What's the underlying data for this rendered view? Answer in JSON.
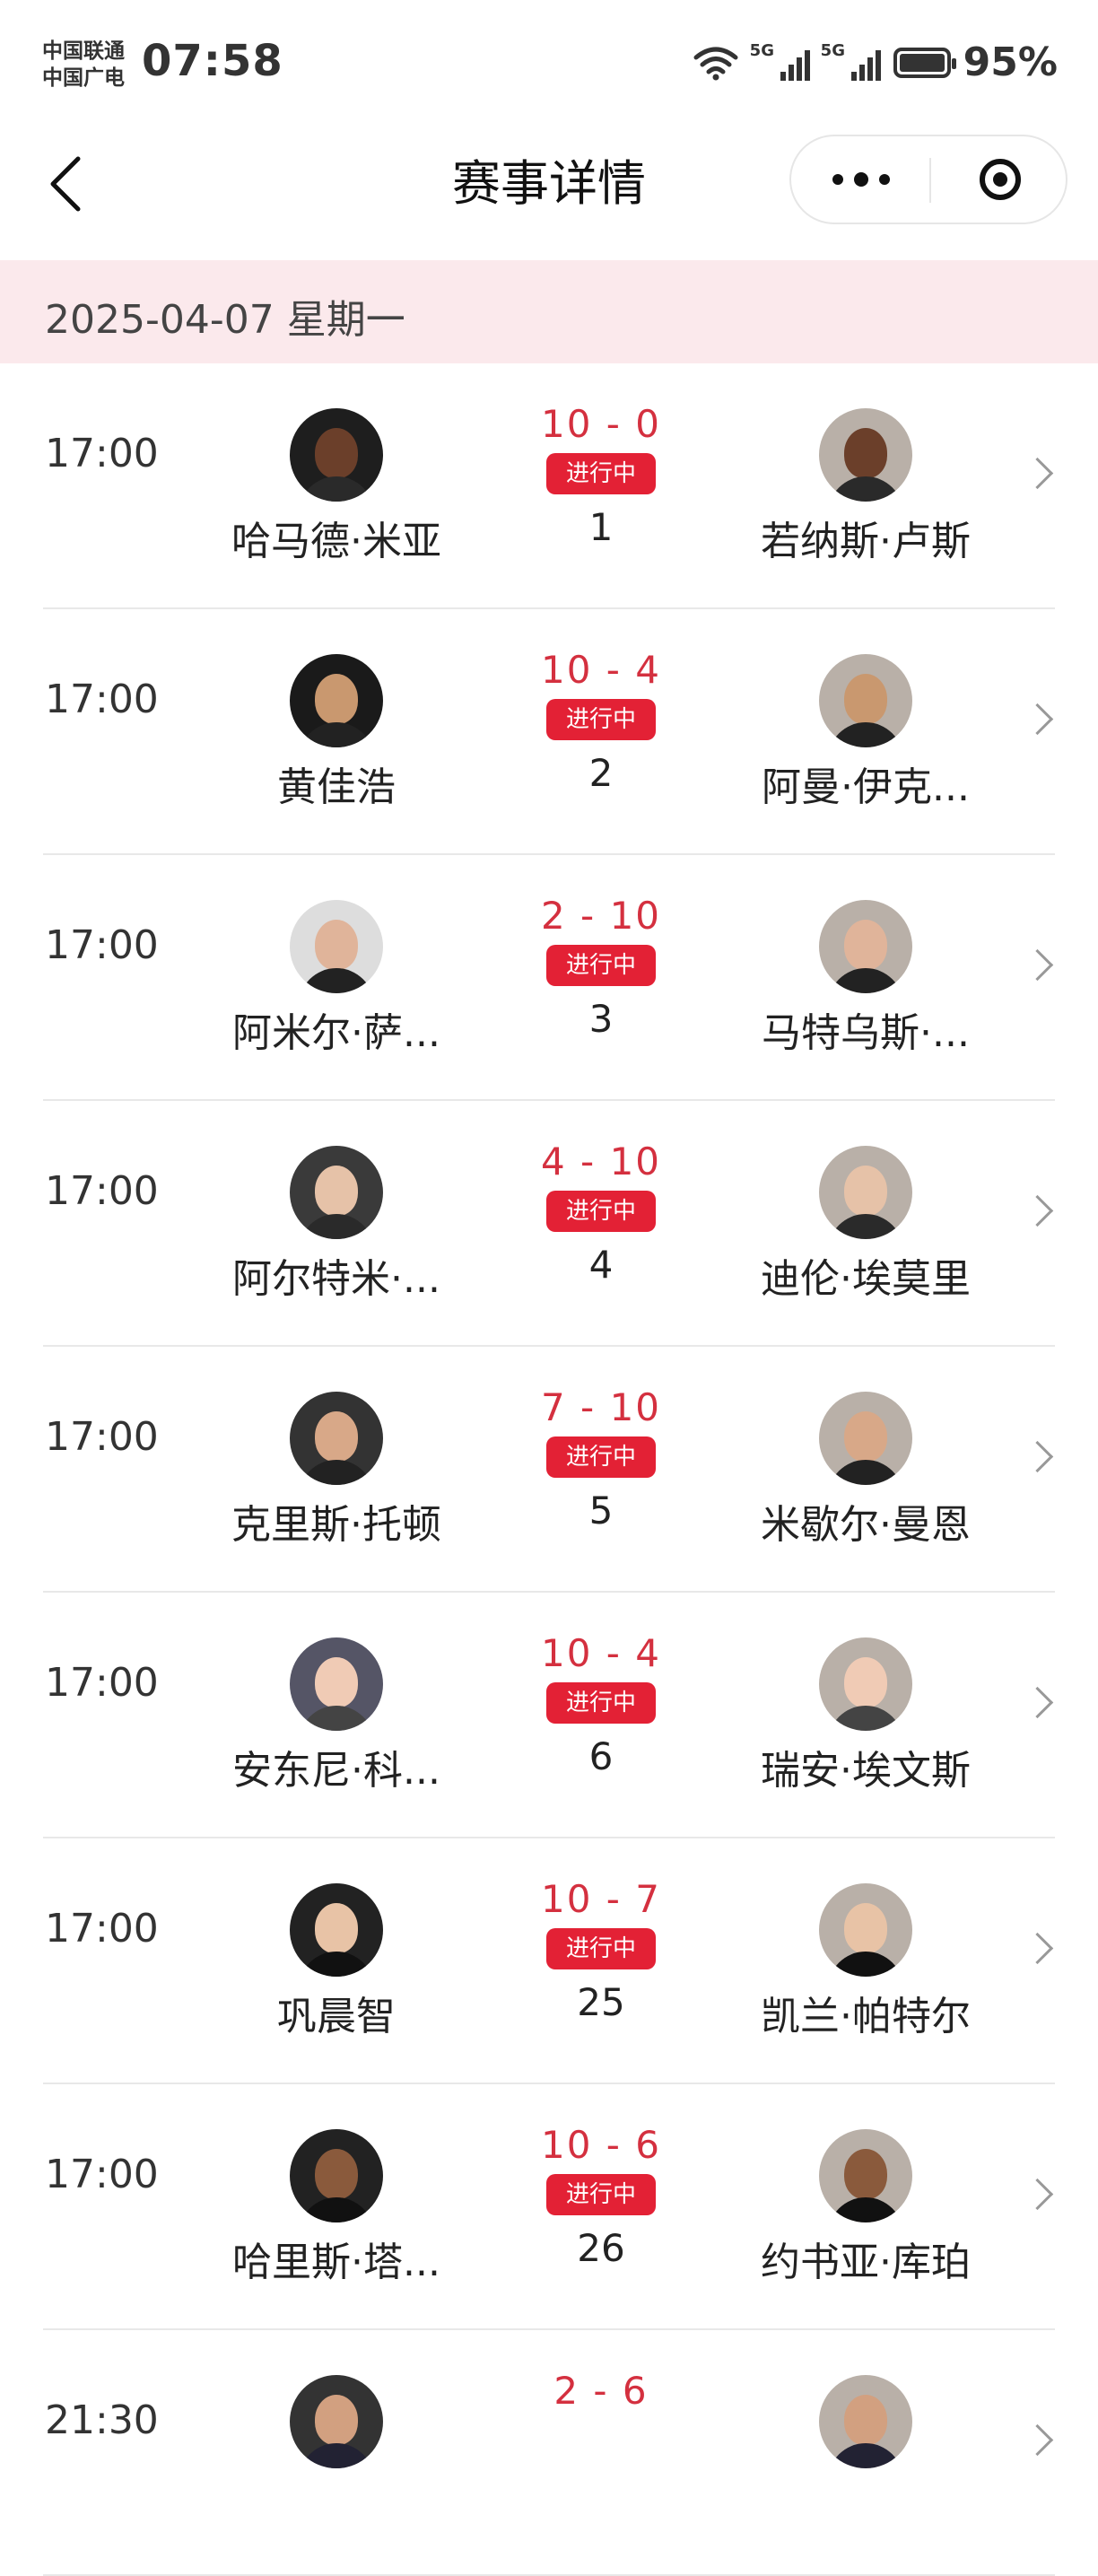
{
  "status_bar": {
    "carrier1": "中国联通",
    "carrier2": "中国广电",
    "time": "07:58",
    "net1": "5G",
    "net2": "5G",
    "battery": "95%"
  },
  "nav": {
    "title": "赛事详情"
  },
  "date_header": "2025-04-07 星期一",
  "colors": {
    "accent": "#e32135",
    "score": "#d4303f",
    "date_bg": "#fbe9ec"
  },
  "matches": [
    {
      "time": "17:00",
      "player1": "哈马德·米亚",
      "score": "10 - 0",
      "status": "进行中",
      "match_no": "1",
      "player2": "若纳斯·卢斯"
    },
    {
      "time": "17:00",
      "player1": "黄佳浩",
      "score": "10 - 4",
      "status": "进行中",
      "match_no": "2",
      "player2": "阿曼·伊克..."
    },
    {
      "time": "17:00",
      "player1": "阿米尔·萨...",
      "score": "2 - 10",
      "status": "进行中",
      "match_no": "3",
      "player2": "马特乌斯·..."
    },
    {
      "time": "17:00",
      "player1": "阿尔特米·...",
      "score": "4 - 10",
      "status": "进行中",
      "match_no": "4",
      "player2": "迪伦·埃莫里"
    },
    {
      "time": "17:00",
      "player1": "克里斯·托顿",
      "score": "7 - 10",
      "status": "进行中",
      "match_no": "5",
      "player2": "米歇尔·曼恩"
    },
    {
      "time": "17:00",
      "player1": "安东尼·科...",
      "score": "10 - 4",
      "status": "进行中",
      "match_no": "6",
      "player2": "瑞安·埃文斯"
    },
    {
      "time": "17:00",
      "player1": "巩晨智",
      "score": "10 - 7",
      "status": "进行中",
      "match_no": "25",
      "player2": "凯兰·帕特尔"
    },
    {
      "time": "17:00",
      "player1": "哈里斯·塔...",
      "score": "10 - 6",
      "status": "进行中",
      "match_no": "26",
      "player2": "约书亚·库珀"
    },
    {
      "time": "21:30",
      "player1": "",
      "score": "2 - 6",
      "status": "",
      "match_no": "",
      "player2": ""
    }
  ]
}
